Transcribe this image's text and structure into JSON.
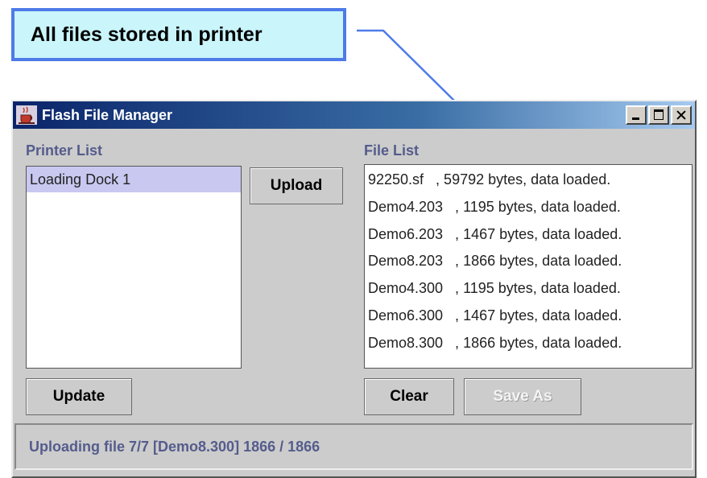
{
  "callout": {
    "text": "All files stored in printer"
  },
  "window": {
    "title": "Flash File Manager",
    "icon": "java-cup-icon",
    "controls": [
      "minimize-icon",
      "maximize-icon",
      "close-icon"
    ]
  },
  "printer_list": {
    "label": "Printer List",
    "items": [
      "Loading Dock 1"
    ],
    "selected": "Loading Dock 1"
  },
  "file_list": {
    "label": "File List",
    "items": [
      "92250.sf   , 59792 bytes, data loaded.",
      "Demo4.203   , 1195 bytes, data loaded.",
      "Demo6.203   , 1467 bytes, data loaded.",
      "Demo8.203   , 1866 bytes, data loaded.",
      "Demo4.300   , 1195 bytes, data loaded.",
      "Demo6.300   , 1467 bytes, data loaded.",
      "Demo8.300   , 1866 bytes, data loaded."
    ]
  },
  "buttons": {
    "upload": "Upload",
    "update": "Update",
    "clear": "Clear",
    "save_as": "Save As"
  },
  "status": {
    "text": "Uploading file 7/7 [Demo8.300] 1866 / 1866"
  },
  "colors": {
    "callout_bg": "#c9f5fb",
    "callout_border": "#4e7be8",
    "label_text": "#555c8c",
    "selection": "#c8c8f0"
  }
}
